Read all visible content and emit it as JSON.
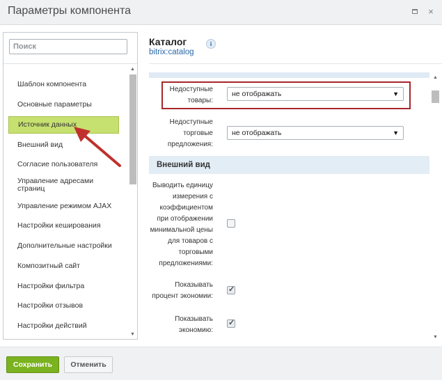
{
  "window": {
    "title": "Параметры компонента",
    "maximize_icon": "maximize-icon",
    "close_icon": "close-icon",
    "close_glyph": "×"
  },
  "sidebar": {
    "search_placeholder": "Поиск",
    "items": [
      {
        "label": "Шаблон компонента"
      },
      {
        "label": "Основные параметры"
      },
      {
        "label": "Источник данных",
        "active": true
      },
      {
        "label": "Внешний вид"
      },
      {
        "label": "Согласие пользователя"
      },
      {
        "label": "Управление адресами страниц"
      },
      {
        "label": "Управление режимом AJAX"
      },
      {
        "label": "Настройки кеширования"
      },
      {
        "label": "Дополнительные настройки"
      },
      {
        "label": "Композитный сайт"
      },
      {
        "label": "Настройки фильтра"
      },
      {
        "label": "Настройки отзывов"
      },
      {
        "label": "Настройки действий"
      }
    ]
  },
  "component": {
    "title": "Каталог",
    "code": "bitrix:catalog",
    "info_glyph": "i"
  },
  "params": {
    "unavailable_products": {
      "label": "Недоступные товары:",
      "value": "не отображать"
    },
    "unavailable_offers": {
      "label": "Недоступные торговые предложения:",
      "value": "не отображать"
    },
    "section_view": "Внешний вид",
    "show_measure": {
      "label": "Выводить единицу измерения с коэффициентом при отображении минимальной цены для товаров с торговыми предложениями:",
      "checked": false
    },
    "show_discount_percent": {
      "label": "Показывать процент экономии:",
      "checked": true
    },
    "show_savings": {
      "label": "Показывать экономию:",
      "checked": true
    }
  },
  "footer": {
    "save_label": "Сохранить",
    "cancel_label": "Отменить"
  },
  "colors": {
    "active_item": "#c6e16f",
    "save_button": "#7bb21f",
    "highlight_border": "#a7262a",
    "annotation_arrow": "#c0312d",
    "link": "#2b6aa6"
  }
}
